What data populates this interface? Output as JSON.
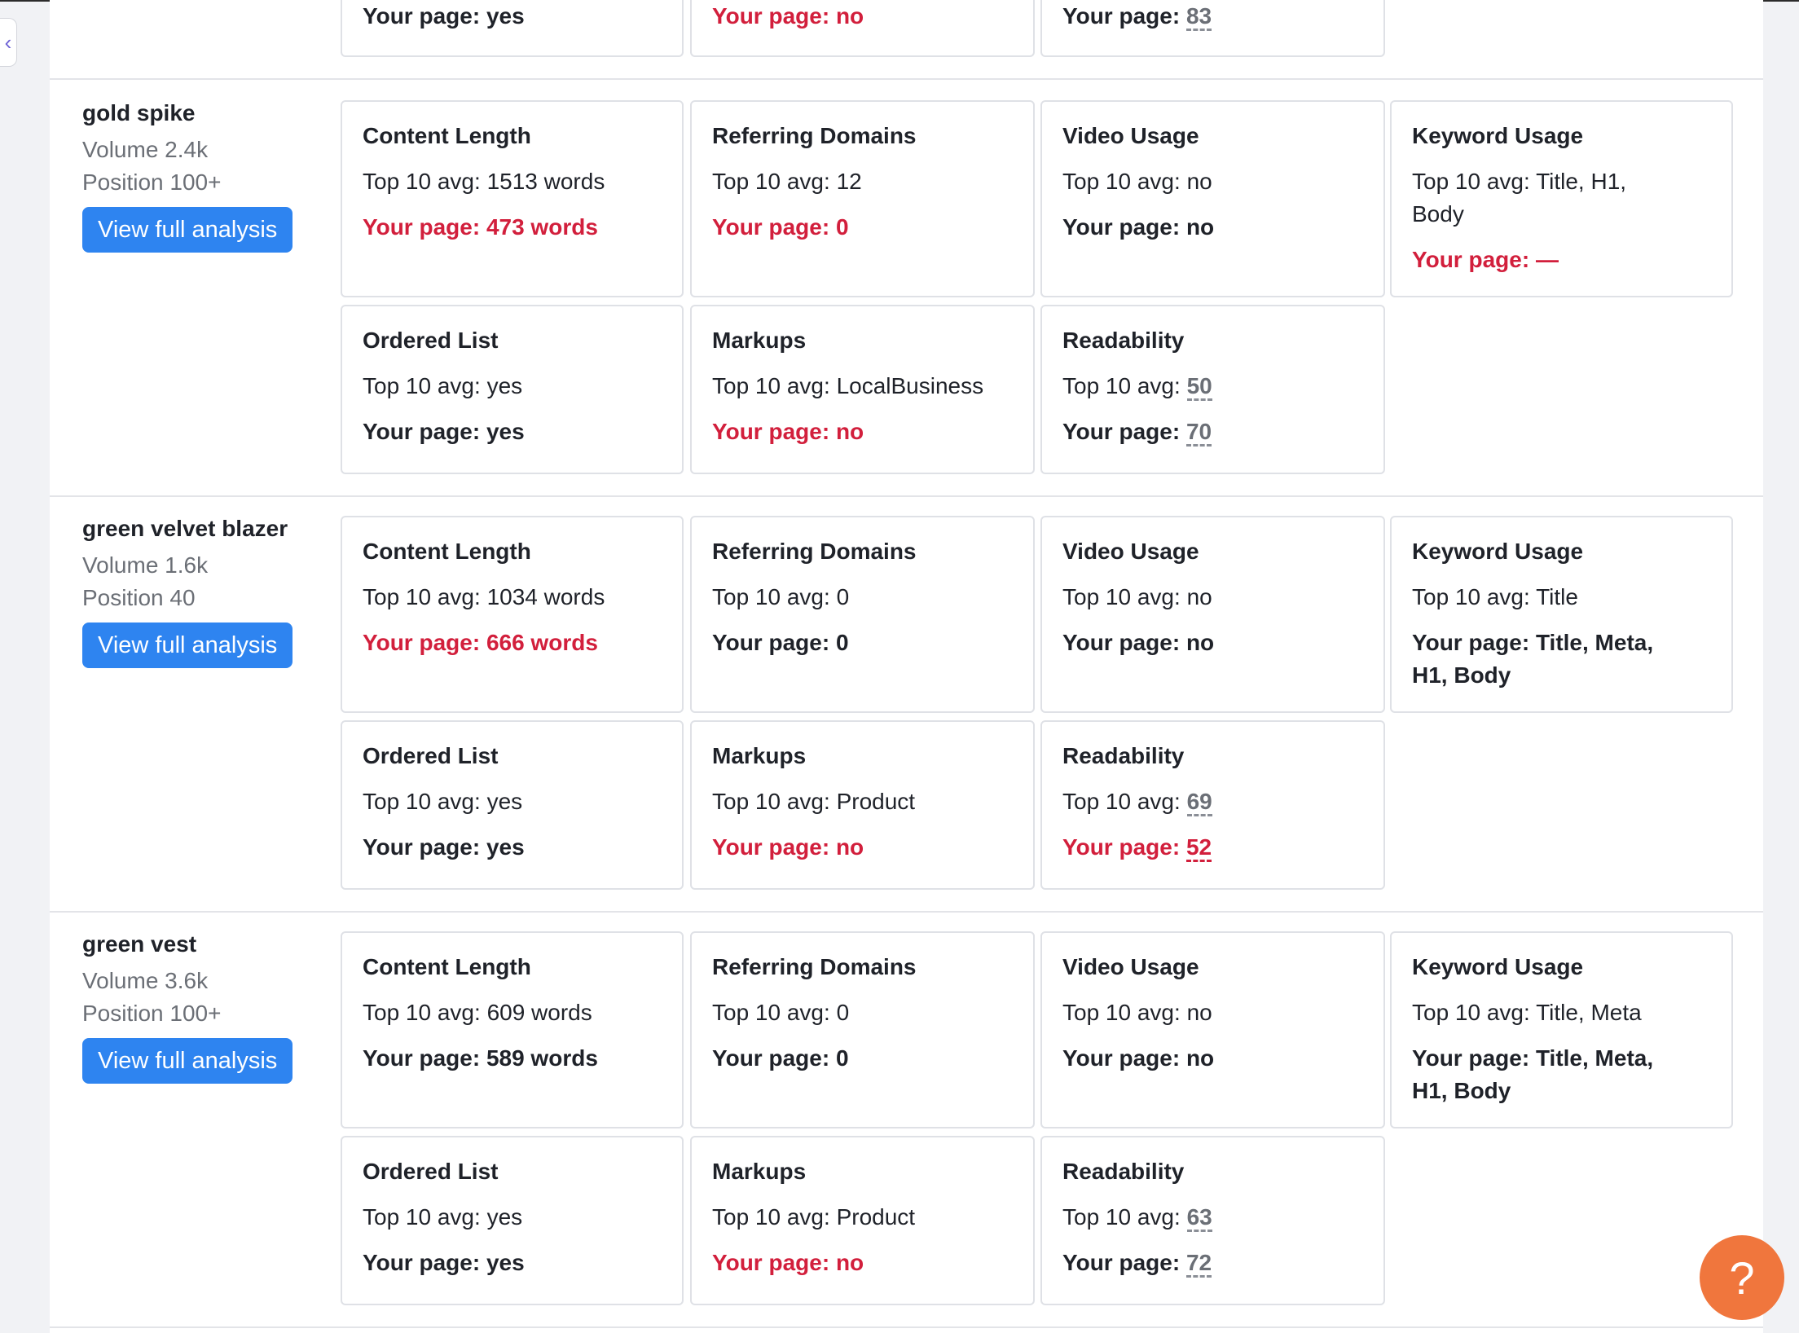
{
  "ui": {
    "view_button_label": "View full analysis",
    "top_avg_prefix": "Top 10 avg:",
    "your_page_prefix": "Your page:",
    "help_label": "?",
    "collapse_label": "‹"
  },
  "colors": {
    "accent": "#2e84f0",
    "bad": "#d21f3c",
    "help": "#f0763d"
  },
  "partial_row": {
    "cards": [
      {
        "your": "yes",
        "status": "ok"
      },
      {
        "your": "no",
        "status": "bad"
      },
      {
        "your": "83",
        "status": "ok",
        "dotted": true
      }
    ]
  },
  "keywords": [
    {
      "name": "gold spike",
      "volume": "Volume 2.4k",
      "position": "Position 100+",
      "content_length": {
        "title": "Content Length",
        "top": "1513 words",
        "your": "473 words",
        "status": "bad"
      },
      "referring_domains": {
        "title": "Referring Domains",
        "top": "12",
        "your": "0",
        "status": "bad"
      },
      "video_usage": {
        "title": "Video Usage",
        "top": "no",
        "your": "no",
        "status": "ok"
      },
      "keyword_usage": {
        "title": "Keyword Usage",
        "top_l1": "Title, H1,",
        "top_l2": "Body",
        "your_l1": "—",
        "your_l2": "",
        "status": "bad"
      },
      "ordered_list": {
        "title": "Ordered List",
        "top": "yes",
        "your": "yes",
        "status": "ok"
      },
      "markups": {
        "title": "Markups",
        "top": "LocalBusiness",
        "your": "no",
        "status": "bad"
      },
      "readability": {
        "title": "Readability",
        "top": "50",
        "your": "70",
        "status": "ok"
      }
    },
    {
      "name": "green velvet blazer",
      "volume": "Volume 1.6k",
      "position": "Position 40",
      "content_length": {
        "title": "Content Length",
        "top": "1034 words",
        "your": "666 words",
        "status": "bad"
      },
      "referring_domains": {
        "title": "Referring Domains",
        "top": "0",
        "your": "0",
        "status": "ok"
      },
      "video_usage": {
        "title": "Video Usage",
        "top": "no",
        "your": "no",
        "status": "ok"
      },
      "keyword_usage": {
        "title": "Keyword Usage",
        "top_l1": "Title",
        "top_l2": "",
        "your_l1": "Title, Meta,",
        "your_l2": "H1, Body",
        "status": "ok"
      },
      "ordered_list": {
        "title": "Ordered List",
        "top": "yes",
        "your": "yes",
        "status": "ok"
      },
      "markups": {
        "title": "Markups",
        "top": "Product",
        "your": "no",
        "status": "bad"
      },
      "readability": {
        "title": "Readability",
        "top": "69",
        "your": "52",
        "status": "bad"
      }
    },
    {
      "name": "green vest",
      "volume": "Volume 3.6k",
      "position": "Position 100+",
      "content_length": {
        "title": "Content Length",
        "top": "609 words",
        "your": "589 words",
        "status": "ok"
      },
      "referring_domains": {
        "title": "Referring Domains",
        "top": "0",
        "your": "0",
        "status": "ok"
      },
      "video_usage": {
        "title": "Video Usage",
        "top": "no",
        "your": "no",
        "status": "ok"
      },
      "keyword_usage": {
        "title": "Keyword Usage",
        "top_l1": "Title, Meta",
        "top_l2": "",
        "your_l1": "Title, Meta,",
        "your_l2": "H1, Body",
        "status": "ok"
      },
      "ordered_list": {
        "title": "Ordered List",
        "top": "yes",
        "your": "yes",
        "status": "ok"
      },
      "markups": {
        "title": "Markups",
        "top": "Product",
        "your": "no",
        "status": "bad"
      },
      "readability": {
        "title": "Readability",
        "top": "63",
        "your": "72",
        "status": "ok"
      }
    }
  ]
}
